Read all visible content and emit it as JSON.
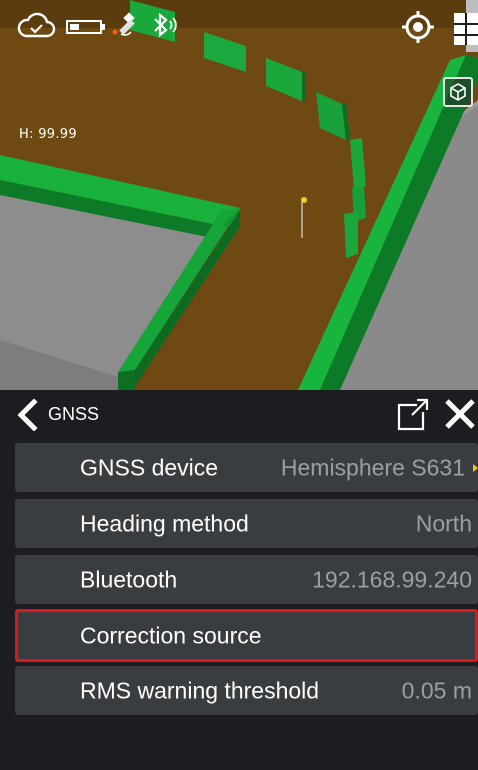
{
  "viewport": {
    "height_readout": "H: 99.99"
  },
  "status_icons": [
    "cloud-sync-icon",
    "battery-icon",
    "satellite-icon",
    "bluetooth-icon"
  ],
  "map_buttons": [
    "target-locate-icon",
    "layers-icon",
    "3d-cube-icon"
  ],
  "panel": {
    "title": "GNSS",
    "rows": [
      {
        "label": "GNSS device",
        "value": "Hemisphere S631",
        "has_arrow": true
      },
      {
        "label": "Heading method",
        "value": "North"
      },
      {
        "label": "Bluetooth",
        "value": "192.168.99.240"
      },
      {
        "label": "Correction source",
        "value": "",
        "selected": true
      },
      {
        "label": "RMS warning threshold",
        "value": "0.05 m"
      }
    ]
  },
  "colors": {
    "ground": "#6e4a12",
    "wall_green": "#16a538",
    "surface_gray": "#8a8a8a",
    "panel_bg": "#1b1d20",
    "row_bg": "#3a3d40",
    "selection_border": "#e0161c",
    "value_text": "#9b9ea2"
  }
}
